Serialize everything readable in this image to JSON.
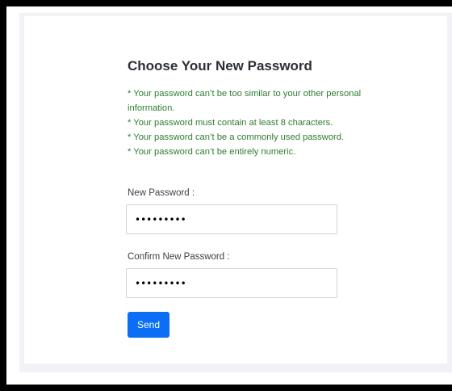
{
  "form": {
    "title": "Choose Your New Password",
    "rules": [
      "* Your password can’t be too similar to your other personal information.",
      "* Your password must contain at least 8 characters.",
      "* Your password can’t be a commonly used password.",
      "* Your password can’t be entirely numeric."
    ],
    "new_password": {
      "label": "New Password :",
      "value": "mynewpwd1"
    },
    "confirm_password": {
      "label": "Confirm New Password :",
      "value": "mynewpwd1"
    },
    "submit_label": "Send"
  },
  "colors": {
    "rule_text": "#2e7d32",
    "button": "#0b6ef5",
    "panel_background": "#f0f2f5"
  }
}
